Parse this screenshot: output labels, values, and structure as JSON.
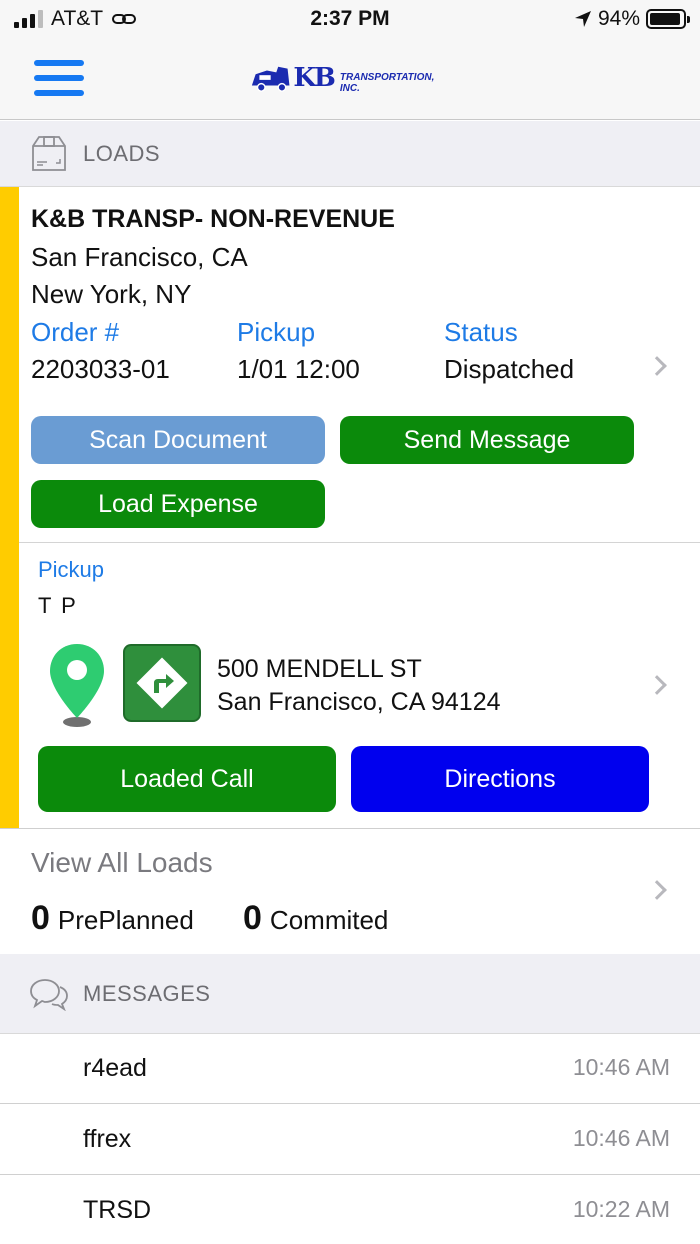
{
  "status_bar": {
    "carrier": "AT&T",
    "time": "2:37 PM",
    "battery": "94%",
    "battery_level": 0.94,
    "icons": [
      "signal-icon",
      "link-icon",
      "location-arrow-icon",
      "battery-icon"
    ]
  },
  "nav": {
    "menu_icon": "hamburger-menu-icon",
    "logo_kb": "KB",
    "logo_text": "TRANSPORTATION, INC."
  },
  "loads_section": {
    "title": "LOADS",
    "icon": "package-box-icon"
  },
  "load": {
    "customer": "K&B TRANSP- NON-REVENUE",
    "origin": "San Francisco, CA",
    "destination": "New York, NY",
    "order_label": "Order #",
    "order_value": "2203033-01",
    "pickup_label": "Pickup",
    "pickup_value": "1/01 12:00",
    "status_label": "Status",
    "status_value": "Dispatched",
    "buttons": {
      "scan_document": "Scan Document",
      "send_message": "Send Message",
      "load_expense": "Load Expense"
    },
    "stop": {
      "type_label": "Pickup",
      "name": "T P",
      "address_line1": "500 MENDELL ST",
      "address_line2": "San Francisco, CA 94124",
      "loaded_call": "Loaded Call",
      "directions": "Directions"
    },
    "colors": {
      "accent_bar": "#ffcc00",
      "label_blue": "#1e7be6",
      "green_button": "#0b8a0b",
      "blue_button": "#0000ee",
      "disabled_button": "#6a9cd3"
    }
  },
  "view_all": {
    "title": "View All Loads",
    "preplanned_count": "0",
    "preplanned_label": "PrePlanned",
    "committed_count": "0",
    "committed_label": "Commited"
  },
  "messages_section": {
    "title": "MESSAGES",
    "icon": "chat-bubbles-icon",
    "items": [
      {
        "text": "r4ead",
        "time": "10:46 AM"
      },
      {
        "text": "ffrex",
        "time": "10:46 AM"
      },
      {
        "text": "TRSD",
        "time": "10:22 AM"
      }
    ]
  }
}
